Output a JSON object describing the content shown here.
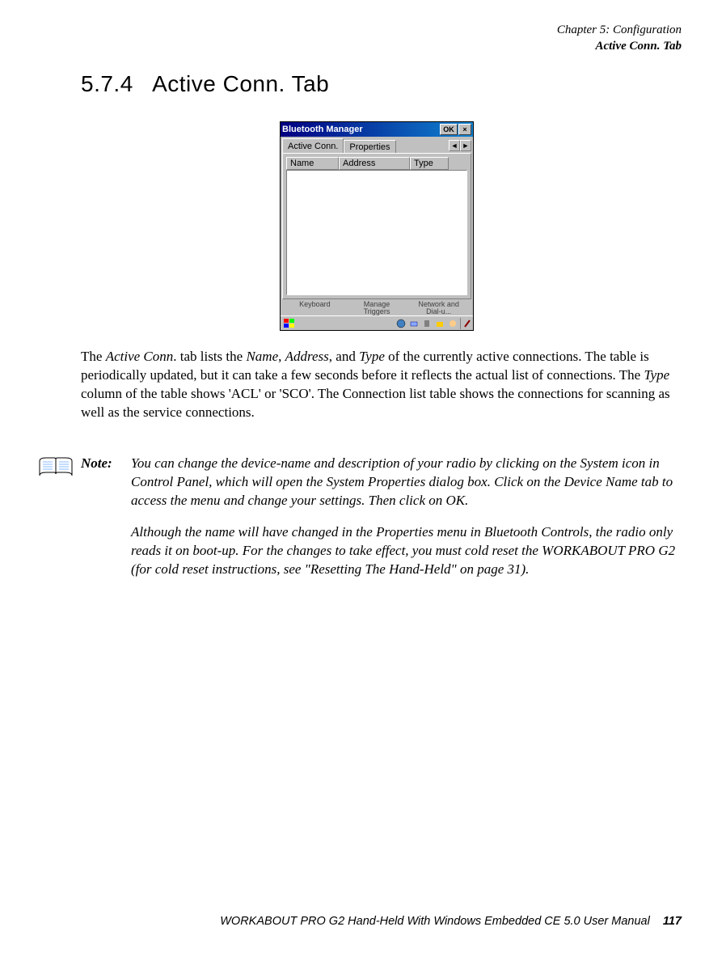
{
  "header": {
    "chapter": "Chapter 5: Configuration",
    "section": "Active Conn. Tab"
  },
  "heading": {
    "number": "5.7.4",
    "title": "Active Conn. Tab"
  },
  "screenshot": {
    "window_title": "Bluetooth Manager",
    "ok_btn": "OK",
    "close_btn": "×",
    "tabs": {
      "active": "Active Conn.",
      "inactive": "Properties",
      "nav_left": "◄",
      "nav_right": "►"
    },
    "columns": {
      "name": "Name",
      "address": "Address",
      "type": "Type"
    },
    "bg_labels": {
      "keyboard": "Keyboard",
      "manage": "Manage Triggers",
      "network": "Network and Dial-u..."
    },
    "taskbar": {
      "start": "⊞"
    }
  },
  "body_para": {
    "t1": "The ",
    "t2": "Active Conn",
    "t3": ". tab lists the ",
    "t4": "Name",
    "t5": ", ",
    "t6": "Address",
    "t7": ", and ",
    "t8": "Type",
    "t9": " of the currently active connections. The table is periodically updated, but it can take a few seconds before it reflects the actual list of connections. The ",
    "t10": "Type",
    "t11": " column of the table shows 'ACL' or 'SCO'. The Connection list table shows the connections for scanning as well as the service connections."
  },
  "note": {
    "label": "Note:",
    "p1": "You can change the device-name and description of your radio by clicking on the System icon in Control Panel, which will open the System Properties dialog box. Click on the Device Name tab to access the menu and change your settings. Then click on OK.",
    "p2": "Although the name will have changed in the Properties menu in Bluetooth Controls, the radio only reads it on boot-up. For the changes to take effect, you must cold reset the WORKABOUT PRO G2 (for cold reset instructions, see \"Resetting The Hand-Held\" on page 31)."
  },
  "footer": {
    "text": "WORKABOUT PRO G2 Hand-Held With Windows Embedded CE 5.0 User Manual",
    "page": "117"
  }
}
